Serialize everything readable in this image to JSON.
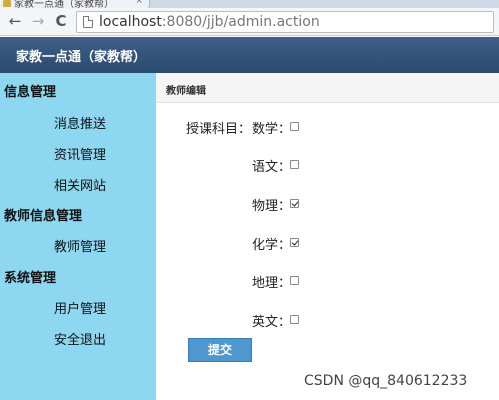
{
  "browser": {
    "tab_title": "家教一点通（家教帮）",
    "tab_close": "×",
    "url_host": "localhost",
    "url_rest": ":8080/jjb/admin.action",
    "back": "←",
    "forward": "→",
    "reload": "C"
  },
  "app": {
    "title": "家教一点通（家教帮）"
  },
  "sidebar": {
    "groups": [
      {
        "title": "信息管理",
        "items": [
          "消息推送",
          "资讯管理",
          "相关网站"
        ]
      },
      {
        "title": "教师信息管理",
        "items": [
          "教师管理"
        ]
      },
      {
        "title": "系统管理",
        "items": [
          "用户管理",
          "安全退出"
        ]
      }
    ]
  },
  "content": {
    "title": "教师编辑",
    "field_label": "授课科目：",
    "subjects": [
      {
        "label": "数学：",
        "checked": false
      },
      {
        "label": "语文：",
        "checked": false
      },
      {
        "label": "物理：",
        "checked": true
      },
      {
        "label": "化学：",
        "checked": true
      },
      {
        "label": "地理：",
        "checked": false
      },
      {
        "label": "英文：",
        "checked": false
      }
    ],
    "submit_label": "提交"
  },
  "watermark": "CSDN @qq_840612233"
}
